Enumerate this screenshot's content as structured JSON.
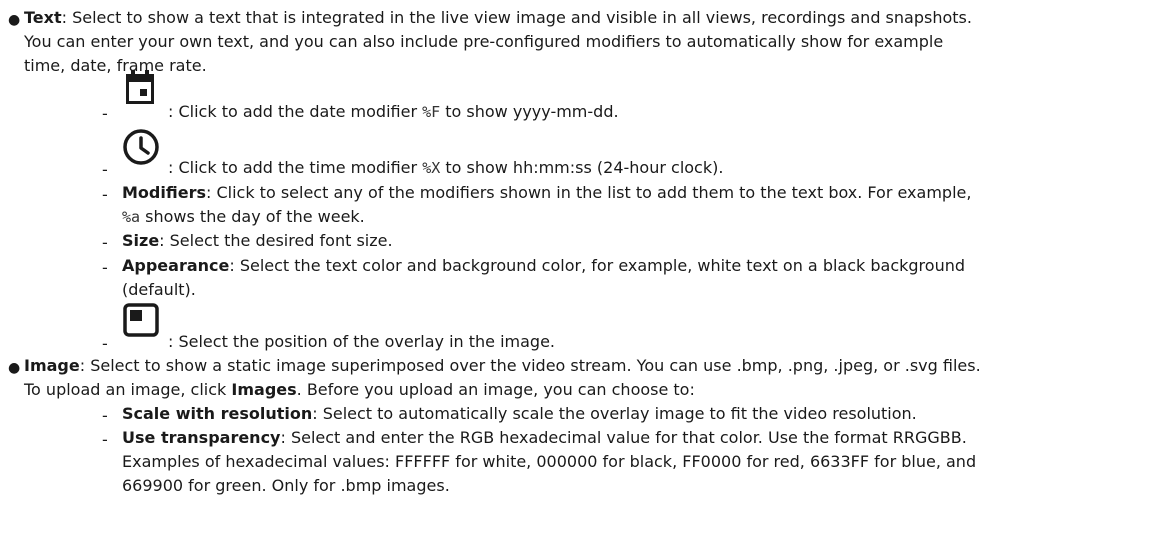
{
  "text_item": {
    "label": "Text",
    "line1": ": Select to show a text that is integrated in the live view image and visible in all views, recordings and snapshots.",
    "line2": "You can enter your own text, and you can also include pre-configured modifiers to automatically show for example",
    "line3": "time, date, frame rate.",
    "date": {
      "icon": "calendar-icon",
      "before": ": Click to add the date modifier ",
      "code": "%F",
      "after": " to show yyyy-mm-dd."
    },
    "time": {
      "icon": "clock-icon",
      "before": ": Click to add the time modifier ",
      "code": "%X",
      "after": " to show hh:mm:ss (24-hour clock)."
    },
    "modifiers": {
      "label": "Modifiers",
      "line1": ": Click to select any of the modifiers shown in the list to add them to the text box. For example,",
      "code": "%a",
      "line2": " shows the day of the week."
    },
    "size": {
      "label": "Size",
      "text": ": Select the desired font size."
    },
    "appearance": {
      "label": "Appearance",
      "line1": ": Select the text color and background color, for example, white text on a black background",
      "line2": "(default)."
    },
    "position": {
      "icon": "position-icon",
      "text": ": Select the position of the overlay in the image."
    }
  },
  "image_item": {
    "label": "Image",
    "line1": ": Select to show a static image superimposed over the video stream. You can use .bmp, .png, .jpeg, or .svg files.",
    "line2_before": "To upload an image, click ",
    "line2_bold": "Images",
    "line2_after": ". Before you upload an image, you can choose to:",
    "scale": {
      "label": "Scale with resolution",
      "text": ": Select to automatically scale the overlay image to fit the video resolution."
    },
    "transparency": {
      "label": "Use transparency",
      "line1": ": Select and enter the RGB hexadecimal value for that color. Use the format RRGGBB.",
      "line2": "Examples of hexadecimal values: FFFFFF for white, 000000 for black, FF0000 for red, 6633FF for blue, and",
      "line3": "669900 for green. Only for .bmp images."
    }
  },
  "colors": {
    "icon": "#1a1a1a",
    "text": "#1a1a1a"
  }
}
